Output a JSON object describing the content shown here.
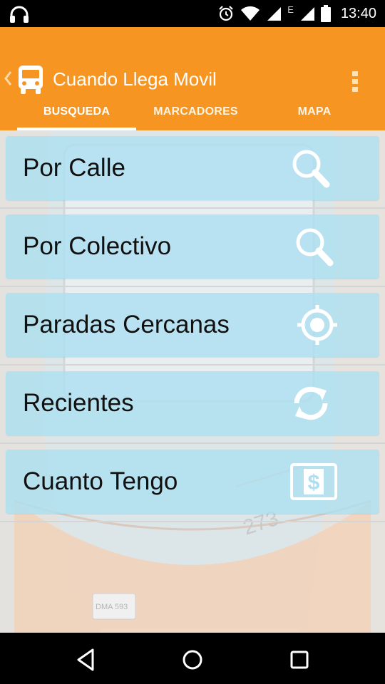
{
  "status_bar": {
    "time": "13:40",
    "network_label": "E",
    "icons": [
      "headphones-icon",
      "alarm-icon",
      "wifi-icon",
      "signal-icon",
      "battery-icon"
    ]
  },
  "app_bar": {
    "title": "Cuando Llega Movil",
    "background_color": "#F79522",
    "app_icon": "bus-icon",
    "overflow_icon": "overflow-menu-icon"
  },
  "tabs": [
    {
      "label": "BUSQUEDA",
      "selected": true
    },
    {
      "label": "MARCADORES",
      "selected": false
    },
    {
      "label": "MAPA",
      "selected": false
    }
  ],
  "menu": [
    {
      "label": "Por Calle",
      "icon": "search-icon"
    },
    {
      "label": "Por Colectivo",
      "icon": "search-icon"
    },
    {
      "label": "Paradas Cercanas",
      "icon": "location-target-icon"
    },
    {
      "label": "Recientes",
      "icon": "refresh-icon"
    },
    {
      "label": "Cuanto Tengo",
      "icon": "dollar-card-icon"
    }
  ],
  "background_art": {
    "bus_number": "273",
    "plate": "DMA 593"
  },
  "nav_bar": {
    "icons": [
      "back-icon",
      "home-icon",
      "recents-icon"
    ]
  }
}
